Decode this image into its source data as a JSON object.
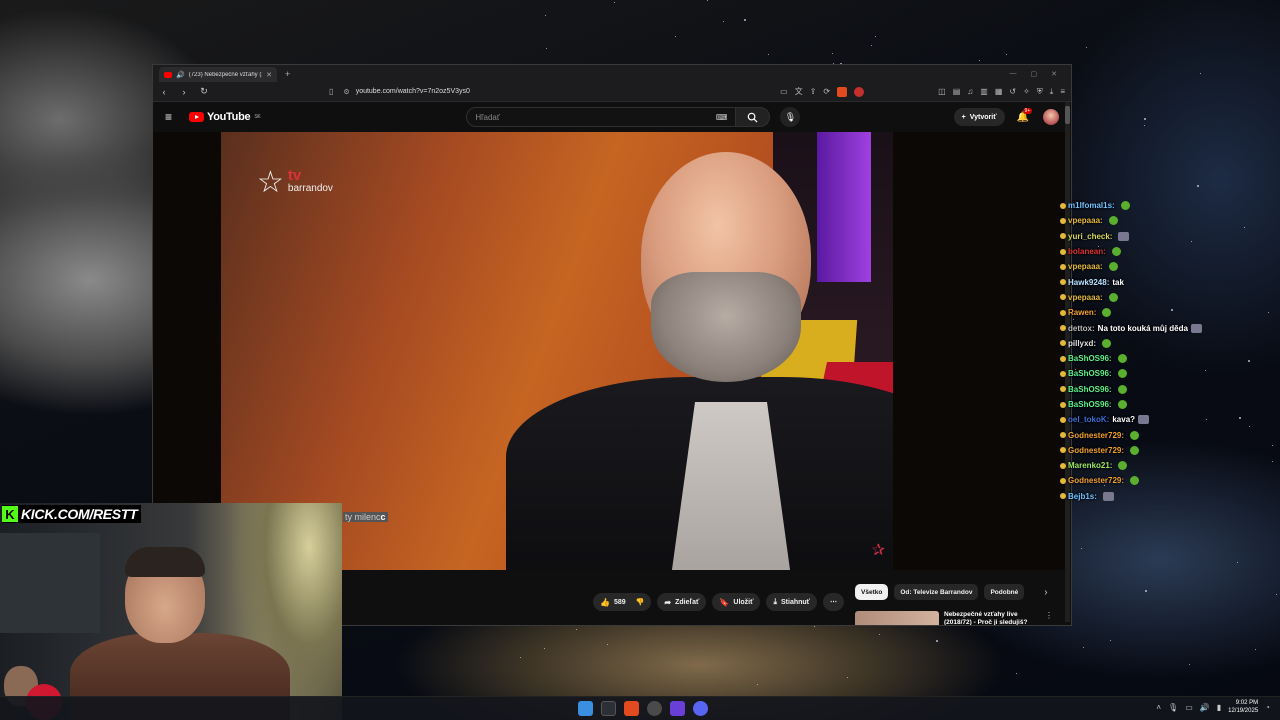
{
  "browser": {
    "tab_title": "(723) Nebezpečné vzťahy (20",
    "url": "youtube.com/watch?v=7n2oz5V3ys0"
  },
  "youtube": {
    "logo_text": "YouTube",
    "region": "SK",
    "search_placeholder": "Hľadať",
    "create_label": "Vytvoriť",
    "notif_count": "9+",
    "like_count": "589",
    "share_label": "Zdieľať",
    "save_label": "Uložiť",
    "download_label": "Stiahnuť",
    "filters": [
      "Všetko",
      "Od: Televize Barrandov",
      "Podobné"
    ],
    "recommended_title": "Nebezpečné vzťahy live (2018/72) - Proč ji sledujiš?"
  },
  "video": {
    "channel_tv": "tv",
    "channel_brand": "barrandov",
    "subtitle_dim": "ty milenc",
    "subtitle_bright": "c"
  },
  "chat": [
    {
      "user": "m1lfomal1s:",
      "text": "",
      "color": "#6ec3ff",
      "emote": true
    },
    {
      "user": "vpepaaa:",
      "text": "",
      "color": "#e4b93a",
      "emote": true
    },
    {
      "user": "yuri_check:",
      "text": "",
      "color": "#d7d95a",
      "emote": "img"
    },
    {
      "user": "bolanean:",
      "text": "",
      "color": "#e03030",
      "emote": true
    },
    {
      "user": "vpepaaa:",
      "text": "",
      "color": "#e4b93a",
      "emote": true
    },
    {
      "user": "Hawk9248:",
      "text": "tak",
      "color": "#b8e0ff",
      "emote": false
    },
    {
      "user": "vpepaaa:",
      "text": "",
      "color": "#e4b93a",
      "emote": true
    },
    {
      "user": "Rawen:",
      "text": "",
      "color": "#f0a030",
      "emote": true
    },
    {
      "user": "dettox:",
      "text": "Na toto kouká můj děda",
      "color": "#bbbbbb",
      "emote": "img"
    },
    {
      "user": "pillyxd:",
      "text": "",
      "color": "#e0e0e0",
      "emote": true
    },
    {
      "user": "BaShOS96:",
      "text": "",
      "color": "#5cf08a",
      "emote": true
    },
    {
      "user": "BaShOS96:",
      "text": "",
      "color": "#5cf08a",
      "emote": true
    },
    {
      "user": "BaShOS96:",
      "text": "",
      "color": "#5cf08a",
      "emote": true
    },
    {
      "user": "BaShOS96:",
      "text": "",
      "color": "#5cf08a",
      "emote": true
    },
    {
      "user": "oel_tokoK:",
      "text": "kava?",
      "color": "#3a6ed8",
      "emote": "img"
    },
    {
      "user": "Godnester729:",
      "text": "",
      "color": "#f0a030",
      "emote": true
    },
    {
      "user": "Godnester729:",
      "text": "",
      "color": "#f0a030",
      "emote": true
    },
    {
      "user": "Marenko21:",
      "text": "",
      "color": "#9de860",
      "emote": true
    },
    {
      "user": "Godnester729:",
      "text": "",
      "color": "#f0a030",
      "emote": true
    },
    {
      "user": "Bejb1s:",
      "text": "",
      "color": "#6ec3ff",
      "emote": "img"
    }
  ],
  "overlay": {
    "kick_letter": "K",
    "kick_url": "KICK.COM/RESTT"
  },
  "taskbar": {
    "time": "9:02 PM",
    "date": "12/19/2025"
  }
}
